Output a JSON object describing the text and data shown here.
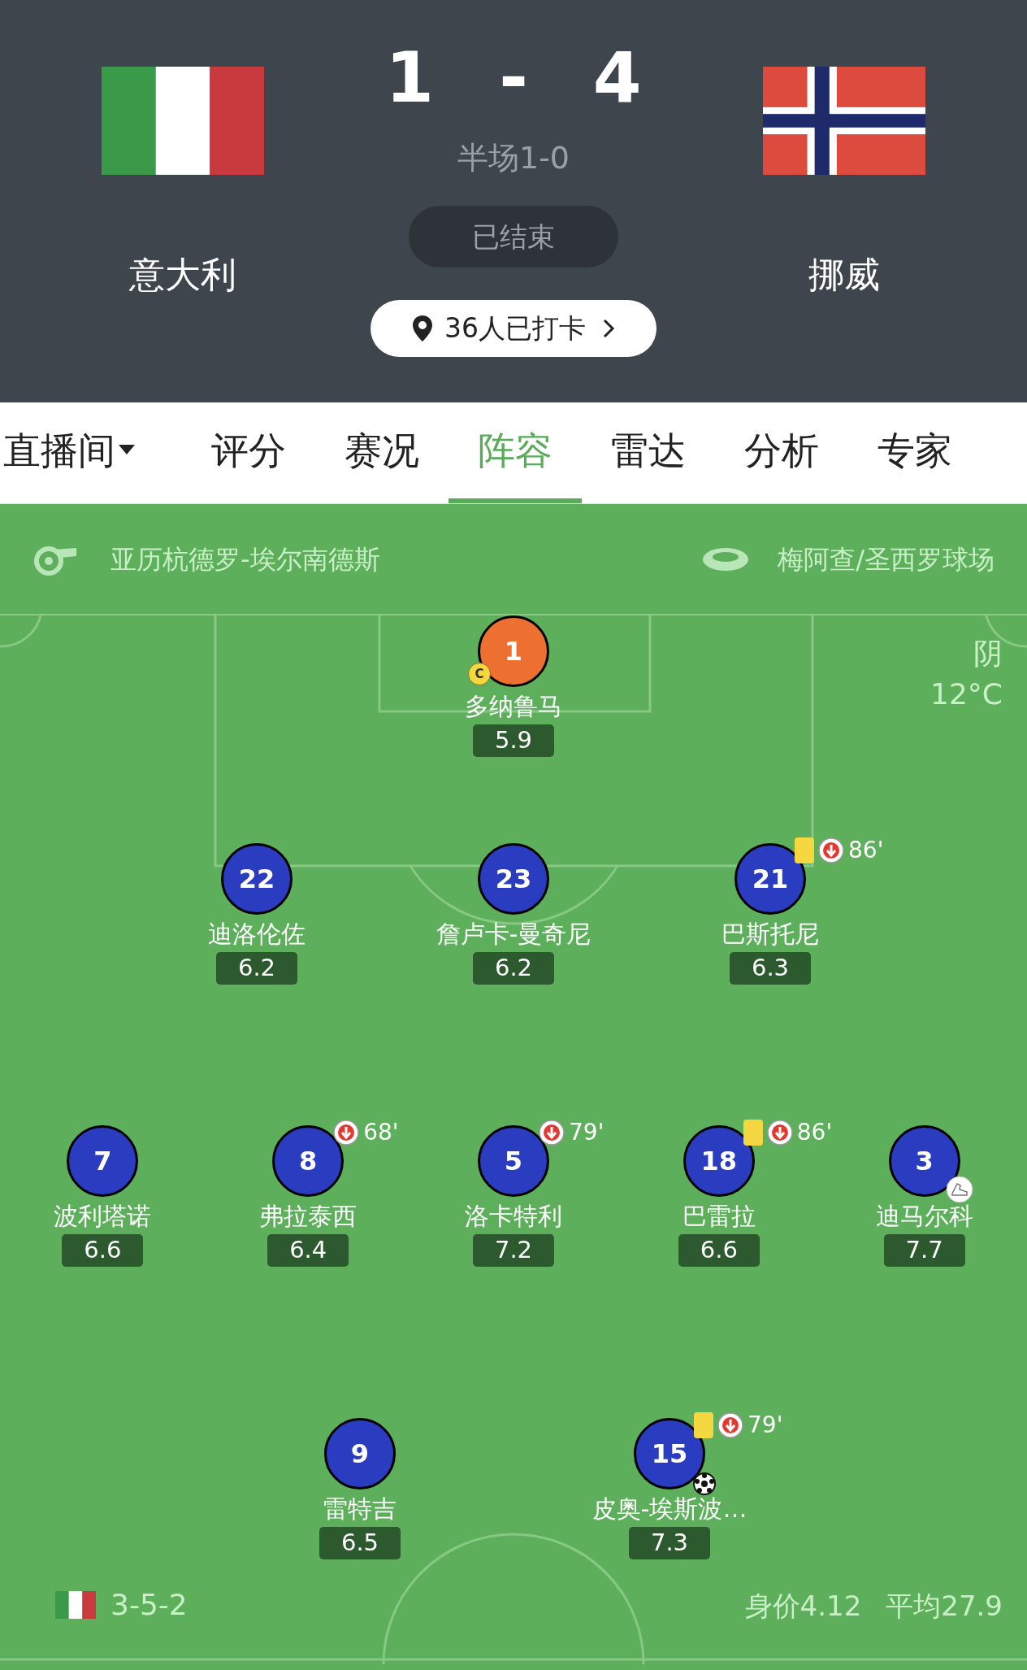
{
  "match": {
    "home": {
      "name": "意大利",
      "score": "1"
    },
    "away": {
      "name": "挪威",
      "score": "4"
    },
    "separator": "-",
    "half_time": "半场1-0",
    "status": "已结束",
    "checkin": "36人已打卡"
  },
  "tabs": [
    {
      "label": "直播间",
      "selected": false,
      "dropdown": true
    },
    {
      "label": "评分",
      "selected": false,
      "dropdown": false
    },
    {
      "label": "赛况",
      "selected": false,
      "dropdown": false
    },
    {
      "label": "阵容",
      "selected": true,
      "dropdown": false
    },
    {
      "label": "雷达",
      "selected": false,
      "dropdown": false
    },
    {
      "label": "分析",
      "selected": false,
      "dropdown": false
    },
    {
      "label": "专家",
      "selected": false,
      "dropdown": false
    }
  ],
  "info": {
    "referee": "亚历杭德罗-埃尔南德斯",
    "stadium": "梅阿查/圣西罗球场",
    "weather": "阴",
    "temperature": "12°C"
  },
  "lines": [
    [
      {
        "number": "1",
        "name": "多纳鲁马",
        "rating": "5.9",
        "color": "#ee7030",
        "captain": true,
        "yellow_card": false,
        "goal": false,
        "assist": false
      }
    ],
    [
      {
        "number": "22",
        "name": "迪洛伦佐",
        "rating": "6.2",
        "color": "#2a3cc0",
        "captain": false,
        "yellow_card": false,
        "goal": false,
        "assist": false
      },
      {
        "number": "23",
        "name": "詹卢卡-曼奇尼",
        "rating": "6.2",
        "color": "#2a3cc0",
        "captain": false,
        "yellow_card": false,
        "goal": false,
        "assist": false
      },
      {
        "number": "21",
        "name": "巴斯托尼",
        "rating": "6.3",
        "color": "#2a3cc0",
        "captain": false,
        "yellow_card": true,
        "sub_minute": "86'",
        "goal": false,
        "assist": false
      }
    ],
    [
      {
        "number": "7",
        "name": "波利塔诺",
        "rating": "6.6",
        "color": "#2a3cc0",
        "captain": false,
        "yellow_card": false,
        "goal": false,
        "assist": false
      },
      {
        "number": "8",
        "name": "弗拉泰西",
        "rating": "6.4",
        "color": "#2a3cc0",
        "captain": false,
        "yellow_card": false,
        "sub_minute": "68'",
        "goal": false,
        "assist": false
      },
      {
        "number": "5",
        "name": "洛卡特利",
        "rating": "7.2",
        "color": "#2a3cc0",
        "captain": false,
        "yellow_card": false,
        "sub_minute": "79'",
        "goal": false,
        "assist": false
      },
      {
        "number": "18",
        "name": "巴雷拉",
        "rating": "6.6",
        "color": "#2a3cc0",
        "captain": false,
        "yellow_card": true,
        "sub_minute": "86'",
        "goal": false,
        "assist": false
      },
      {
        "number": "3",
        "name": "迪马尔科",
        "rating": "7.7",
        "color": "#2a3cc0",
        "captain": false,
        "yellow_card": false,
        "goal": false,
        "assist": true
      }
    ],
    [
      {
        "number": "9",
        "name": "雷特吉",
        "rating": "6.5",
        "color": "#2a3cc0",
        "captain": false,
        "yellow_card": false,
        "goal": false,
        "assist": false
      },
      {
        "number": "15",
        "name": "皮奥-埃斯波…",
        "rating": "7.3",
        "color": "#2a3cc0",
        "captain": false,
        "yellow_card": true,
        "sub_minute": "79'",
        "goal": true,
        "assist": false
      }
    ]
  ],
  "captain_badge": "C",
  "footer": {
    "formation": "3-5-2",
    "market_value": "身价4.12",
    "average_age": "平均27.9"
  }
}
